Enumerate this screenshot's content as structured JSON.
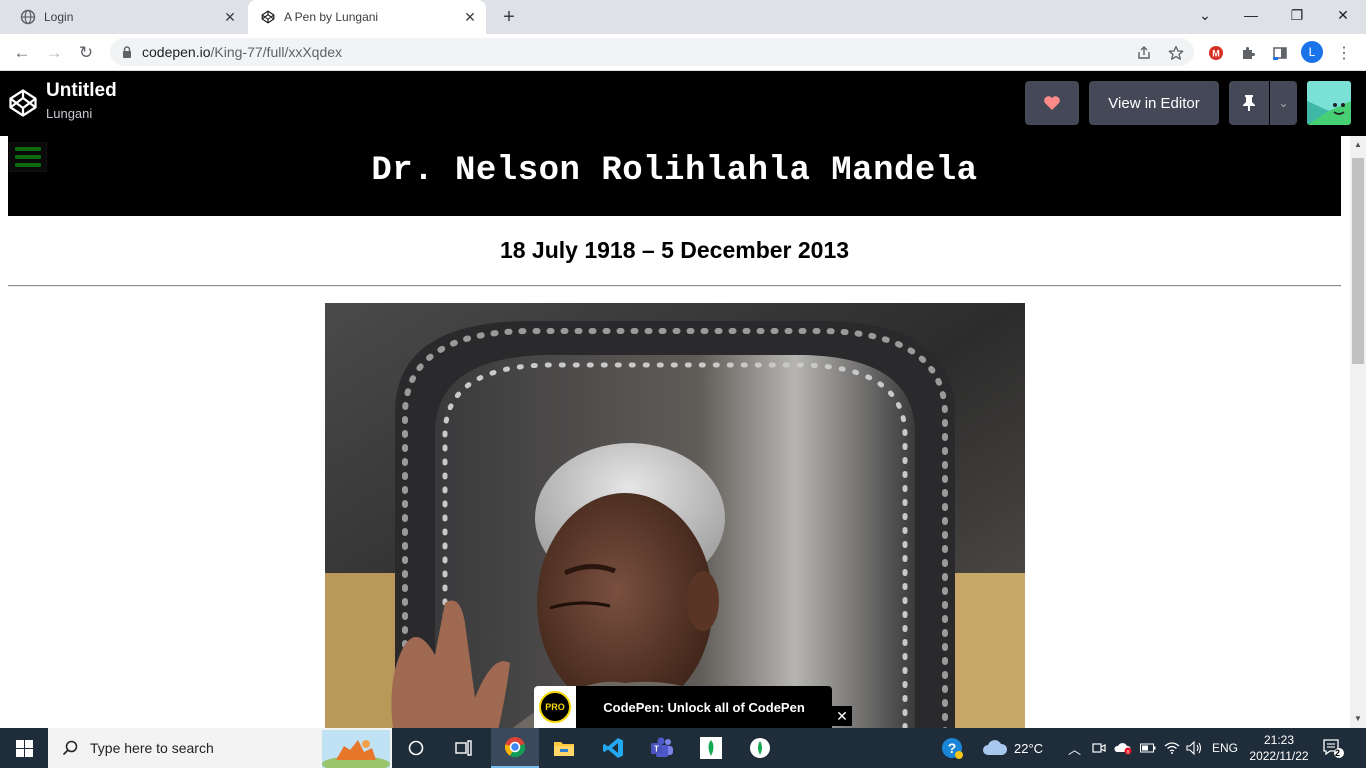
{
  "browser": {
    "tabs": [
      {
        "title": "Login",
        "active": false
      },
      {
        "title": "A Pen by Lungani",
        "active": true
      }
    ],
    "url_host": "codepen.io",
    "url_path": "/King-77/full/xxXqdex",
    "profile_initial": "L"
  },
  "codepen": {
    "title": "Untitled",
    "author": "Lungani",
    "view_in_editor": "View in Editor"
  },
  "page": {
    "heading": "Dr. Nelson Rolihlahla Mandela",
    "dates": "18 July 1918 – 5 December 2013"
  },
  "promo": {
    "badge": "PRO",
    "message": "CodePen: Unlock all of CodePen"
  },
  "taskbar": {
    "search_placeholder": "Type here to search",
    "temperature": "22°C",
    "language": "ENG",
    "time": "21:23",
    "date": "2022/11/22",
    "notification_count": "2"
  },
  "colors": {
    "codepen_header": "#000000",
    "codepen_button": "#444857",
    "heart": "#ff8a8a",
    "menu_bars": "#0b6b0b",
    "taskbar": "#1f2d3a"
  }
}
